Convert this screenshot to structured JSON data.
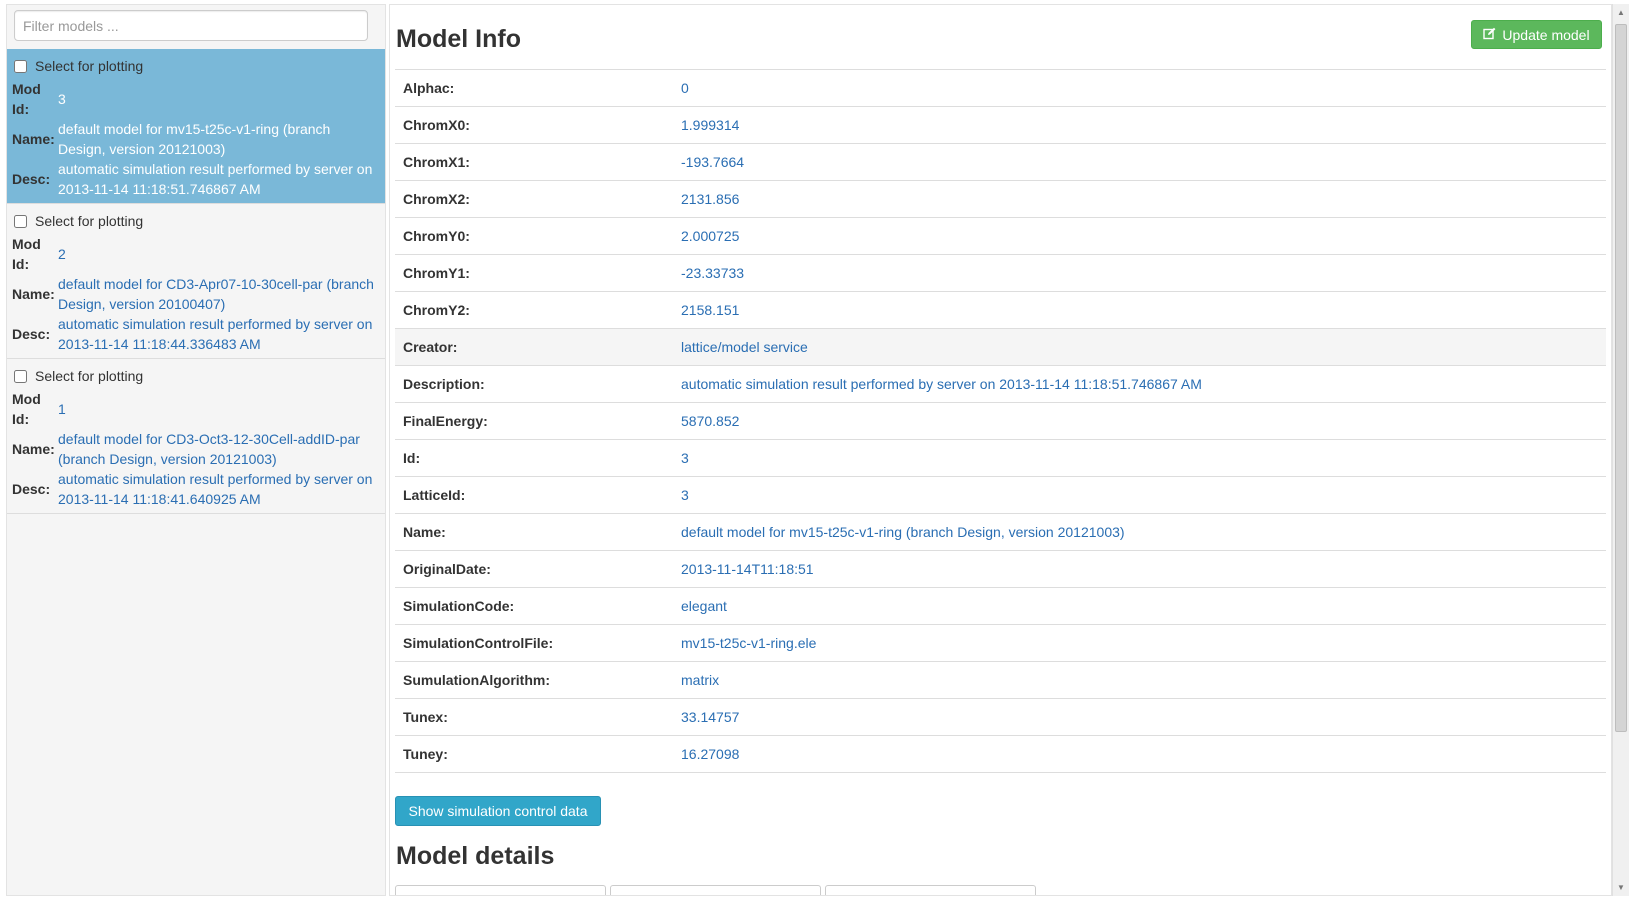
{
  "sidebar": {
    "filter_placeholder": "Filter models ...",
    "select_label": "Select for plotting",
    "labels": {
      "mod_id": "Mod Id:",
      "name": "Name:",
      "desc": "Desc:"
    },
    "models": [
      {
        "id": "3",
        "name": "default model for mv15-t25c-v1-ring (branch Design, version 20121003)",
        "desc": "automatic simulation result performed by server on 2013-11-14 11:18:51.746867 AM",
        "active": true
      },
      {
        "id": "2",
        "name": "default model for CD3-Apr07-10-30cell-par (branch Design, version 20100407)",
        "desc": "automatic simulation result performed by server on 2013-11-14 11:18:44.336483 AM",
        "active": false
      },
      {
        "id": "1",
        "name": "default model for CD3-Oct3-12-30Cell-addID-par (branch Design, version 20121003)",
        "desc": "automatic simulation result performed by server on 2013-11-14 11:18:41.640925 AM",
        "active": false
      }
    ]
  },
  "main": {
    "title": "Model Info",
    "update_button": "Update model",
    "info_rows": [
      {
        "key": "Alphac:",
        "value": "0"
      },
      {
        "key": "ChromX0:",
        "value": "1.999314"
      },
      {
        "key": "ChromX1:",
        "value": "-193.7664"
      },
      {
        "key": "ChromX2:",
        "value": "2131.856"
      },
      {
        "key": "ChromY0:",
        "value": "2.000725"
      },
      {
        "key": "ChromY1:",
        "value": "-23.33733"
      },
      {
        "key": "ChromY2:",
        "value": "2158.151"
      },
      {
        "key": "Creator:",
        "value": "lattice/model service",
        "highlight": true
      },
      {
        "key": "Description:",
        "value": "automatic simulation result performed by server on 2013-11-14 11:18:51.746867 AM"
      },
      {
        "key": "FinalEnergy:",
        "value": "5870.852"
      },
      {
        "key": "Id:",
        "value": "3"
      },
      {
        "key": "LatticeId:",
        "value": "3"
      },
      {
        "key": "Name:",
        "value": "default model for mv15-t25c-v1-ring (branch Design, version 20121003)"
      },
      {
        "key": "OriginalDate:",
        "value": "2013-11-14T11:18:51"
      },
      {
        "key": "SimulationCode:",
        "value": "elegant"
      },
      {
        "key": "SimulationControlFile:",
        "value": "mv15-t25c-v1-ring.ele"
      },
      {
        "key": "SumulationAlgorithm:",
        "value": "matrix"
      },
      {
        "key": "Tunex:",
        "value": "33.14757"
      },
      {
        "key": "Tuney:",
        "value": "16.27098"
      }
    ],
    "show_button": "Show simulation control data",
    "details_title": "Model details"
  },
  "colors": {
    "active_item": "#7ab8d8",
    "link": "#2a6eb3",
    "success_button": "#5cb85c",
    "info_button": "#31a6c9"
  },
  "icons": {
    "update": "edit-icon"
  }
}
